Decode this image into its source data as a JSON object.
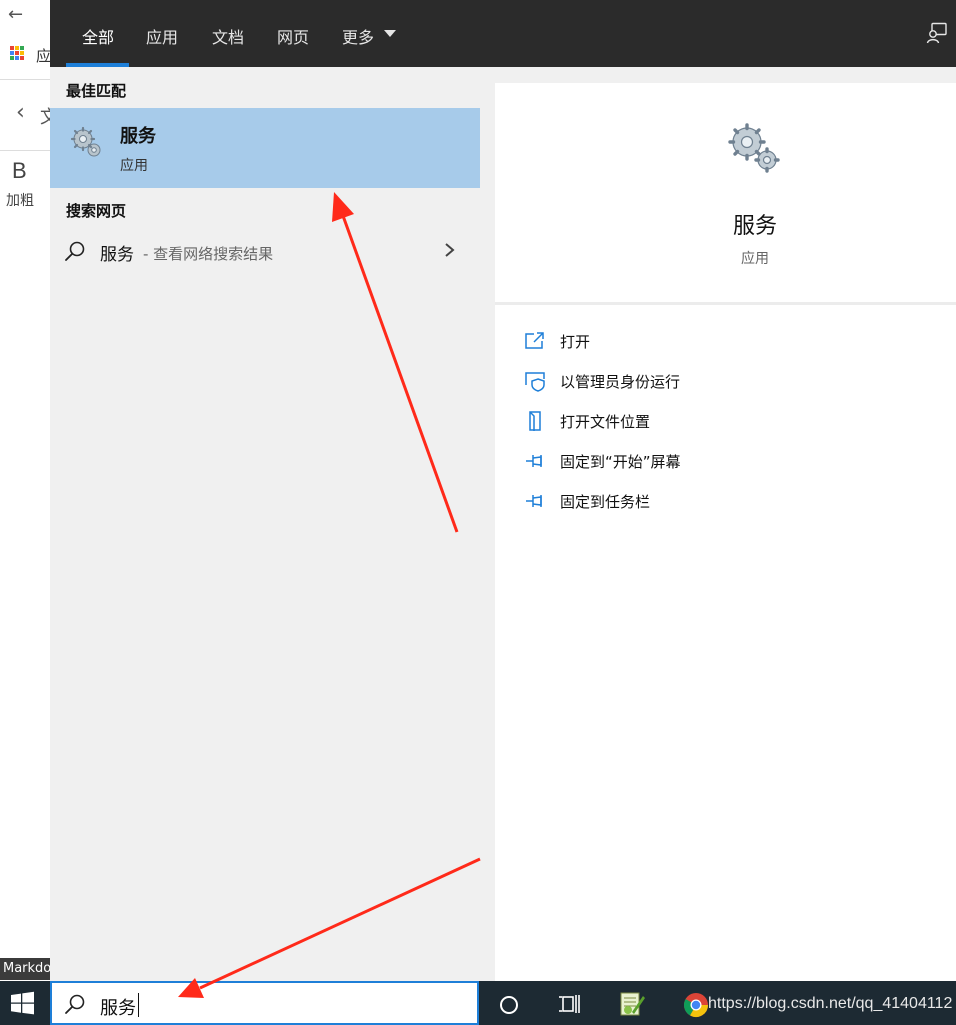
{
  "background_app": {
    "app_text": "应",
    "chevron_text": "文",
    "bold_button": "B",
    "bold_label": "加粗",
    "markdown_label": "Markdown"
  },
  "tabs": [
    {
      "label": "全部",
      "active": true
    },
    {
      "label": "应用"
    },
    {
      "label": "文档"
    },
    {
      "label": "网页"
    },
    {
      "label": "更多"
    }
  ],
  "best_match": {
    "section_title": "最佳匹配",
    "name": "服务",
    "type": "应用"
  },
  "web_search": {
    "section_title": "搜索网页",
    "query": "服务",
    "description": "- 查看网络搜索结果"
  },
  "detail": {
    "name": "服务",
    "type": "应用",
    "actions": [
      {
        "label": "打开",
        "icon": "open-icon"
      },
      {
        "label": "以管理员身份运行",
        "icon": "admin-shield-icon"
      },
      {
        "label": "打开文件位置",
        "icon": "file-location-icon"
      },
      {
        "label": "固定到“开始”屏幕",
        "icon": "pin-icon"
      },
      {
        "label": "固定到任务栏",
        "icon": "pin-icon"
      }
    ]
  },
  "taskbar": {
    "search_value": "服务",
    "watermark": "https://blog.csdn.net/qq_41404112"
  },
  "colors": {
    "accent": "#1e7fd8",
    "selection": "#a7cbea",
    "topbar": "#2b2b2b",
    "taskbar": "#1d2a33",
    "annotation": "#ff2a1a"
  }
}
